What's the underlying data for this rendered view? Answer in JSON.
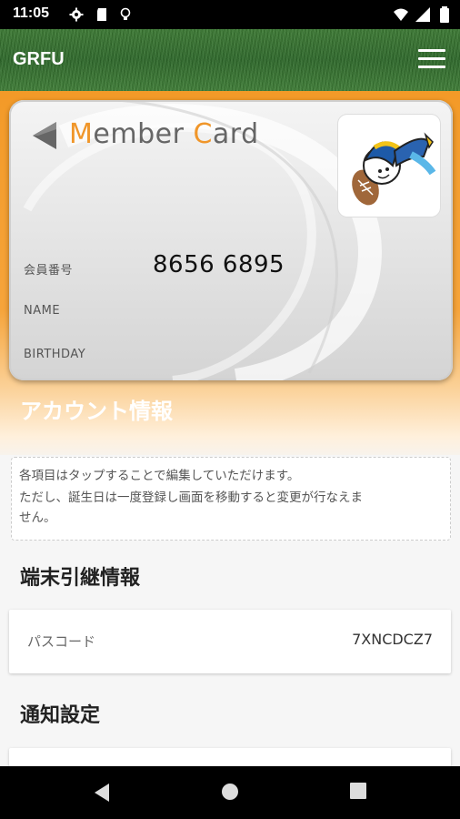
{
  "status_bar": {
    "time": "11:05",
    "left_icons": [
      "settings-icon",
      "sd-card-icon",
      "bulb-icon"
    ],
    "right_icons": [
      "wifi-icon",
      "signal-icon",
      "battery-icon"
    ]
  },
  "app_bar": {
    "title": "GRFU",
    "menu_icon": "hamburger-menu-icon"
  },
  "member_card": {
    "title_prefix_M": "M",
    "title_rest_ember": "ember ",
    "title_C": "C",
    "title_rest_ard": "ard",
    "member_no_label": "会員番号",
    "member_no": "8656 6895",
    "name_label": "NAME",
    "birthday_label": "BIRTHDAY",
    "accent_color": "#f0962a"
  },
  "account": {
    "heading": "アカウント情報",
    "notice_line1": "各項目はタップすることで編集していただけます。",
    "notice_line2": "ただし、誕生日は一度登録し画面を移動すると変更が行なえま",
    "notice_line3": "せん。"
  },
  "transfer": {
    "heading": "端末引継情報",
    "passcode_label": "パスコード",
    "passcode_value": "7XNCDCZ7"
  },
  "notification": {
    "heading": "通知設定"
  },
  "nav_bar": {
    "icons": [
      "back-icon",
      "home-icon",
      "recents-icon"
    ]
  }
}
